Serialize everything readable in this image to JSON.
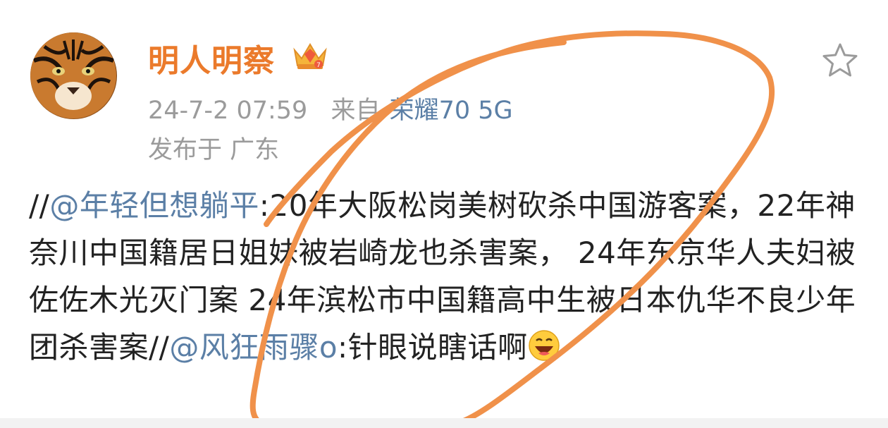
{
  "author": {
    "name": "明人明察",
    "avatar_icon": "tiger-avatar",
    "badge_icon": "crown-badge-icon"
  },
  "meta": {
    "timestamp": "24-7-2 07:59",
    "from_label": "来自",
    "device": "荣耀70 5G",
    "location": "发布于 广东"
  },
  "post": {
    "segments": [
      {
        "type": "text",
        "value": "//"
      },
      {
        "type": "mention",
        "value": "@年轻但想躺平"
      },
      {
        "type": "text",
        "value": ":20年大阪松岗美树砍杀中国游客案，22年神奈川中国籍居日姐妹被岩崎龙也杀害案， 24年东京华人夫妇被佐佐木光灭门案 24年滨松市中国籍高中生被日本仇华不良少年团杀害案//"
      },
      {
        "type": "mention",
        "value": "@风狂雨骤o"
      },
      {
        "type": "text",
        "value": ":针眼说瞎话啊"
      }
    ],
    "emoji": "laughing-emoji"
  },
  "actions": {
    "favorite_icon": "star-icon"
  },
  "colors": {
    "author": "#eb7a2b",
    "link": "#5b7fa6",
    "meta": "#9b9b9b",
    "body": "#222222",
    "scribble": "#f0914a"
  }
}
